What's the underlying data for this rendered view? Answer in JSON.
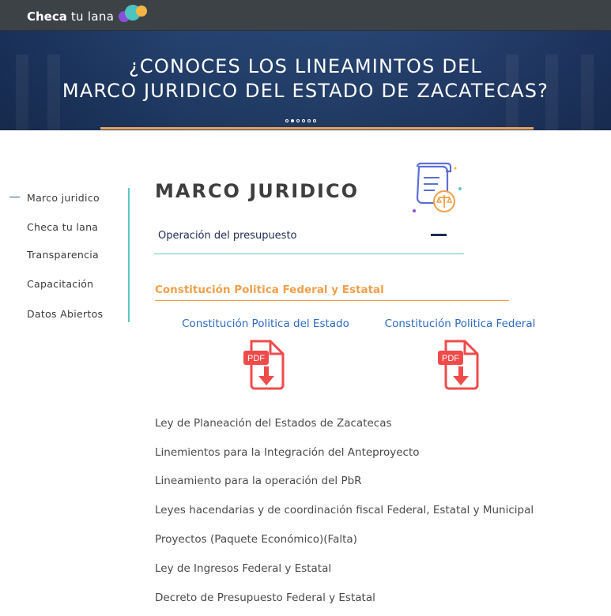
{
  "header": {
    "brand_bold": "Checa",
    "brand_rest": "tu lana"
  },
  "hero": {
    "title_line1": "¿CONOCES LOS LINEAMINTOS DEL",
    "title_line2": "MARCO JURIDICO DEL ESTADO DE ZACATECAS?"
  },
  "sidebar": {
    "items": [
      {
        "label": "Marco juridico",
        "active": true
      },
      {
        "label": "Checa tu lana"
      },
      {
        "label": "Transparencia"
      },
      {
        "label": "Capacitación"
      },
      {
        "label": "Datos Abiertos"
      }
    ]
  },
  "main": {
    "title": "MARCO JURIDICO",
    "accordion": {
      "label": "Operación del presupuesto"
    },
    "section_title": "Constitución Politica Federal y Estatal",
    "pdfs": [
      {
        "label": "Constitución Politica del Estado",
        "badge": "PDF"
      },
      {
        "label": "Constitución Politica Federal",
        "badge": "PDF"
      }
    ],
    "laws": [
      "Ley de Planeación del Estados de Zacatecas",
      "Linemientos para la Integración del Anteproyecto",
      "Lineamiento para la operación del PbR",
      "Leyes hacendarias y de coordinación fiscal Federal, Estatal y Municipal",
      "Proyectos (Paquete Económico)(Falta)",
      "Ley de Ingresos Federal y Estatal",
      "Decreto de Presupuesto Federal y Estatal"
    ]
  },
  "colors": {
    "accent_teal": "#5cc8c4",
    "accent_orange": "#f0a04b",
    "link_blue": "#2c6ac2",
    "pdf_red": "#ef4b4b",
    "topbar": "#3d4247"
  },
  "icons": [
    "brand-bubbles-icon",
    "legal-document-scale-icon",
    "pdf-download-icon"
  ]
}
